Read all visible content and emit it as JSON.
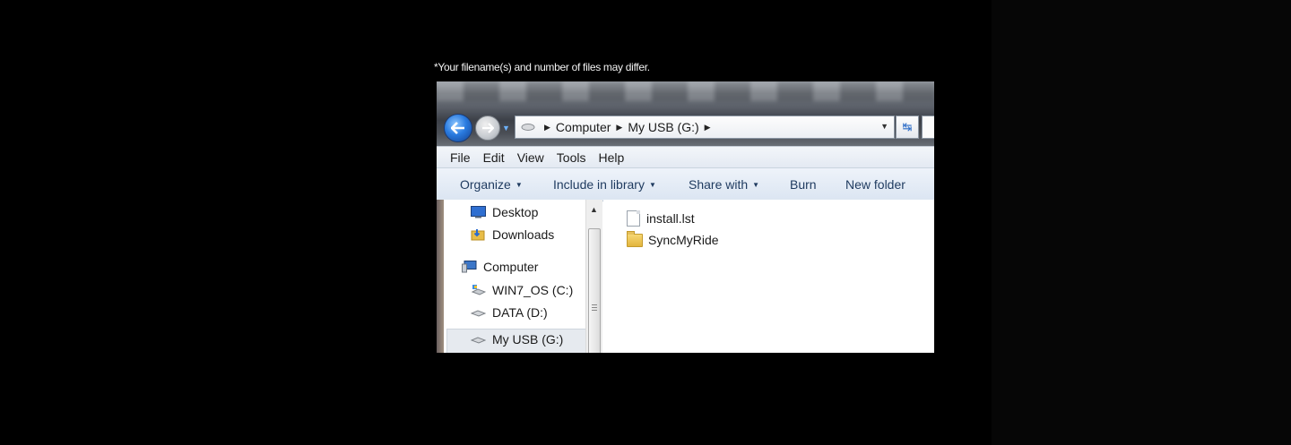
{
  "caption": "*Your filename(s) and number of files may differ.",
  "explorer": {
    "address": {
      "crumbs": [
        "Computer",
        "My USB (G:)"
      ]
    },
    "menu": [
      "File",
      "Edit",
      "View",
      "Tools",
      "Help"
    ],
    "toolbar": {
      "organize": "Organize",
      "include": "Include in library",
      "share": "Share with",
      "burn": "Burn",
      "new_folder": "New folder"
    },
    "nav": {
      "desktop": "Desktop",
      "downloads": "Downloads",
      "computer": "Computer",
      "win7": "WIN7_OS (C:)",
      "data": "DATA (D:)",
      "usb": "My USB (G:)"
    },
    "files": [
      {
        "name": "install.lst",
        "icon": "document-icon"
      },
      {
        "name": "SyncMyRide",
        "icon": "folder-icon"
      }
    ]
  },
  "colors": {
    "background": "#000000",
    "accent": "#2a7be0",
    "folder": "#e8bd48"
  }
}
